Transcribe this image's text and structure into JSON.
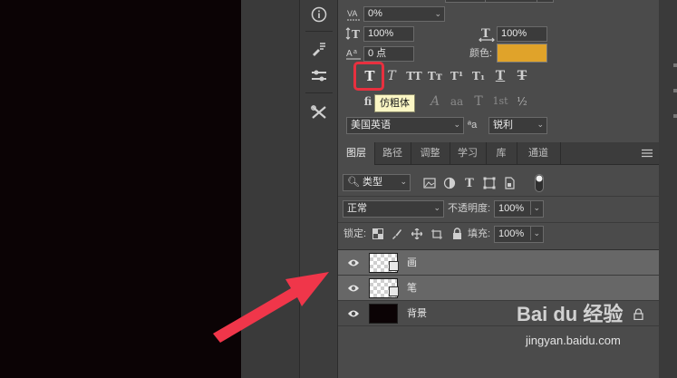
{
  "character_panel": {
    "tracking_value": "0%",
    "vertical_scale": "100%",
    "horizontal_scale": "100%",
    "baseline_shift": "0 点",
    "color_label": "颜色:",
    "color_value": "#e0a32a",
    "tooltip": "仿粗体",
    "style_buttons": [
      "T",
      "T",
      "TT",
      "Tт",
      "T¹",
      "T₁",
      "T",
      "T"
    ],
    "opentype_buttons": [
      "ﬁ",
      "A",
      "aa",
      "T",
      "1st",
      "½"
    ],
    "language": "美国英语",
    "aa_icon": "ªa",
    "antialias": "锐利"
  },
  "layers_panel": {
    "tabs": [
      {
        "label": "图层",
        "active": true
      },
      {
        "label": "路径",
        "active": false
      },
      {
        "label": "调整",
        "active": false
      },
      {
        "label": "学习",
        "active": false
      },
      {
        "label": "库",
        "active": false
      },
      {
        "label": "通道",
        "active": false
      }
    ],
    "filter_kind": "类型",
    "blend_mode": "正常",
    "opacity_label": "不透明度:",
    "opacity_value": "100%",
    "lock_label": "锁定:",
    "fill_label": "填充:",
    "fill_value": "100%",
    "layers": [
      {
        "name": "画",
        "type": "text",
        "selected": true,
        "visible": true
      },
      {
        "name": "笔",
        "type": "text",
        "selected": true,
        "visible": true
      },
      {
        "name": "背景",
        "type": "background",
        "selected": false,
        "visible": true,
        "locked": true
      }
    ]
  },
  "watermark": {
    "brand": "Bai du 经验",
    "url": "jingyan.baidu.com"
  },
  "colors": {
    "highlight_box": "#e8303f",
    "arrow": "#f0364a",
    "swatch": "#e0a32a"
  }
}
